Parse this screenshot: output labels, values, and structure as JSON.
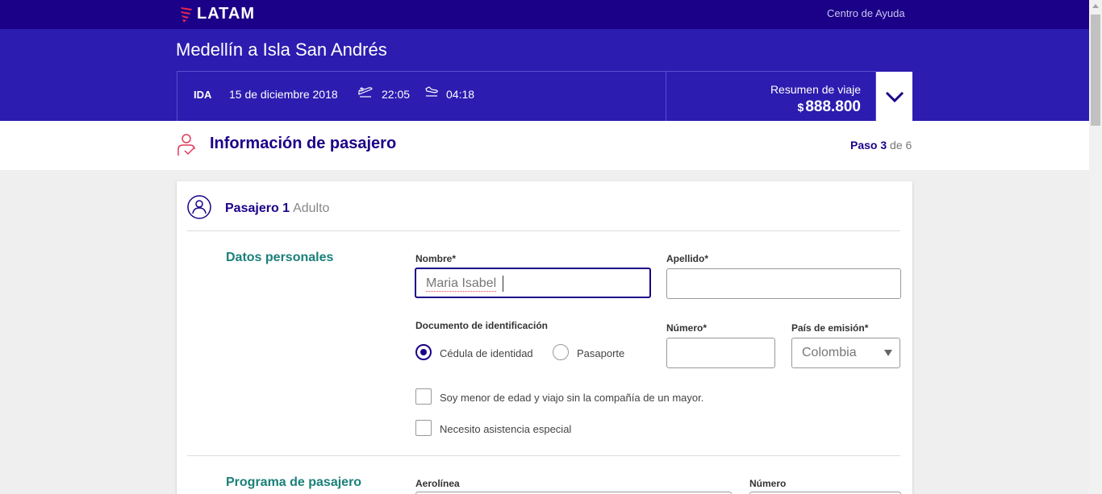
{
  "topbar": {
    "brand": "LATAM",
    "help_link": "Centro de Ayuda"
  },
  "header": {
    "route": "Medellín a Isla San Andrés",
    "flight": {
      "direction": "IDA",
      "date": "15 de diciembre 2018",
      "departure_time": "22:05",
      "arrival_time": "04:18",
      "departure_icon": "takeoff-icon",
      "arrival_icon": "landing-icon"
    },
    "summary": {
      "label": "Resumen de viaje",
      "currency": "$",
      "price": "888.800"
    }
  },
  "step": {
    "title": "Información de pasajero",
    "paso_label": "Paso",
    "current": "3",
    "de_label": "de",
    "total": "6"
  },
  "passenger": {
    "title": "Pasajero 1",
    "type": "Adulto",
    "personal": {
      "section_title": "Datos personales",
      "nombre_label": "Nombre*",
      "nombre_value": "Maria Isabel",
      "apellido_label": "Apellido*",
      "apellido_value": "",
      "documento_label": "Documento de identificación",
      "doc_options": [
        "Cédula de identidad",
        "Pasaporte"
      ],
      "doc_selected": "Cédula de identidad",
      "numero_label": "Número*",
      "numero_value": "",
      "pais_label": "País de emisión*",
      "pais_value": "Colombia",
      "menor_label": "Soy menor de edad y viajo sin la compañía de un mayor.",
      "asistencia_label": "Necesito asistencia especial"
    },
    "program": {
      "section_title": "Programa de pasajero",
      "aerolinea_label": "Aerolínea",
      "numero_label": "Número"
    }
  },
  "colors": {
    "topbar": "#1b0088",
    "header": "#2c1cb0",
    "accent": "#1b0088",
    "section_title": "#1a7f7a",
    "icon_red": "#e03a5a"
  }
}
